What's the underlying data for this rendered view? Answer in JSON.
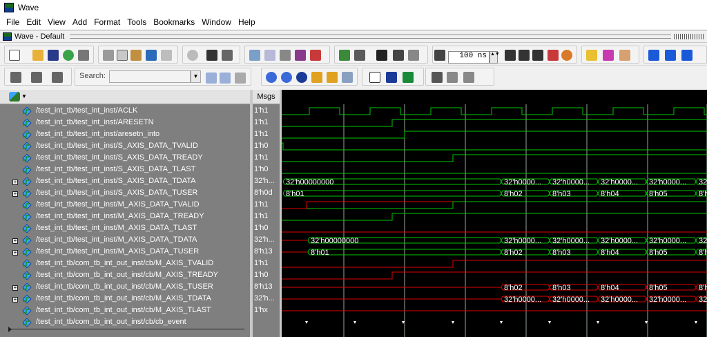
{
  "titlebar": {
    "title": "Wave"
  },
  "menubar": {
    "items": [
      "File",
      "Edit",
      "View",
      "Add",
      "Format",
      "Tools",
      "Bookmarks",
      "Window",
      "Help"
    ]
  },
  "subwindow": {
    "title": "Wave - Default"
  },
  "toolbar": {
    "time_value": "100 ns",
    "search_label": "Search:",
    "search_placeholder": ""
  },
  "wave_header": {
    "msgs_label": "Msgs"
  },
  "colors": {
    "wave_green": "#00c800",
    "wave_red": "#e00000",
    "bus_text": "#ffffff",
    "cursor_line": "#9aa89a",
    "names_bg": "#7f7f7f"
  },
  "signals": [
    {
      "name": "/test_int_tb/test_int_inst/ACLK",
      "value": "1'h1",
      "expandable": false,
      "icon": "signal-icon"
    },
    {
      "name": "/test_int_tb/test_int_inst/ARESETN",
      "value": "1'h1",
      "expandable": false,
      "icon": "signal-icon"
    },
    {
      "name": "/test_int_tb/test_int_inst/aresetn_into",
      "value": "1'h1",
      "expandable": false,
      "icon": "signal-icon"
    },
    {
      "name": "/test_int_tb/test_int_inst/S_AXIS_DATA_TVALID",
      "value": "1'h0",
      "expandable": false,
      "icon": "signal-icon"
    },
    {
      "name": "/test_int_tb/test_int_inst/S_AXIS_DATA_TREADY",
      "value": "1'h1",
      "expandable": false,
      "icon": "signal-icon"
    },
    {
      "name": "/test_int_tb/test_int_inst/S_AXIS_DATA_TLAST",
      "value": "1'h0",
      "expandable": false,
      "icon": "signal-icon"
    },
    {
      "name": "/test_int_tb/test_int_inst/S_AXIS_DATA_TDATA",
      "value": "32'h...",
      "expandable": true,
      "icon": "signal-icon"
    },
    {
      "name": "/test_int_tb/test_int_inst/S_AXIS_DATA_TUSER",
      "value": "8'h0d",
      "expandable": true,
      "icon": "signal-icon"
    },
    {
      "name": "/test_int_tb/test_int_inst/M_AXIS_DATA_TVALID",
      "value": "1'h1",
      "expandable": false,
      "icon": "signal-icon"
    },
    {
      "name": "/test_int_tb/test_int_inst/M_AXIS_DATA_TREADY",
      "value": "1'h1",
      "expandable": false,
      "icon": "signal-icon"
    },
    {
      "name": "/test_int_tb/test_int_inst/M_AXIS_DATA_TLAST",
      "value": "1'h0",
      "expandable": false,
      "icon": "signal-icon"
    },
    {
      "name": "/test_int_tb/test_int_inst/M_AXIS_DATA_TDATA",
      "value": "32'h...",
      "expandable": true,
      "icon": "signal-icon"
    },
    {
      "name": "/test_int_tb/test_int_inst/M_AXIS_DATA_TUSER",
      "value": "8'h13",
      "expandable": true,
      "icon": "signal-icon"
    },
    {
      "name": "/test_int_tb/com_tb_int_out_inst/cb/M_AXIS_TVALID",
      "value": "1'h1",
      "expandable": false,
      "icon": "signal-icon"
    },
    {
      "name": "/test_int_tb/com_tb_int_out_inst/cb/M_AXIS_TREADY",
      "value": "1'h0",
      "expandable": false,
      "icon": "signal-icon"
    },
    {
      "name": "/test_int_tb/com_tb_int_out_inst/cb/M_AXIS_TUSER",
      "value": "8'h13",
      "expandable": true,
      "icon": "signal-icon"
    },
    {
      "name": "/test_int_tb/com_tb_int_out_inst/cb/M_AXIS_TDATA",
      "value": "32'h...",
      "expandable": true,
      "icon": "signal-icon"
    },
    {
      "name": "/test_int_tb/com_tb_int_out_inst/cb/M_AXIS_TLAST",
      "value": "1'hx",
      "expandable": false,
      "icon": "signal-icon"
    },
    {
      "name": "/test_int_tb/com_tb_int_out_inst/cb/cb_event",
      "value": "",
      "expandable": false,
      "icon": "event-icon"
    }
  ],
  "bus_labels": {
    "s_tdata": [
      "32'h00000000",
      "32'h0000...",
      "32'h0000...",
      "32'h0000...",
      "32'h0000...",
      "32'"
    ],
    "s_tuser": [
      "8'h01",
      "8'h02",
      "8'h03",
      "8'h04",
      "8'h05",
      "8'h"
    ],
    "m_tdata": [
      "32'h00000000",
      "32'h0000...",
      "32'h0000...",
      "32'h0000...",
      "32'h0000...",
      "32'"
    ],
    "m_tuser": [
      "8'h01",
      "8'h02",
      "8'h03",
      "8'h04",
      "8'h05",
      "8'h"
    ],
    "cb_tuser": [
      "8'h02",
      "8'h03",
      "8'h04",
      "8'h05",
      "8'h"
    ],
    "cb_tdata": [
      "32'h0000...",
      "32'h0000...",
      "32'h0000...",
      "32'h0000...",
      "32'"
    ]
  }
}
